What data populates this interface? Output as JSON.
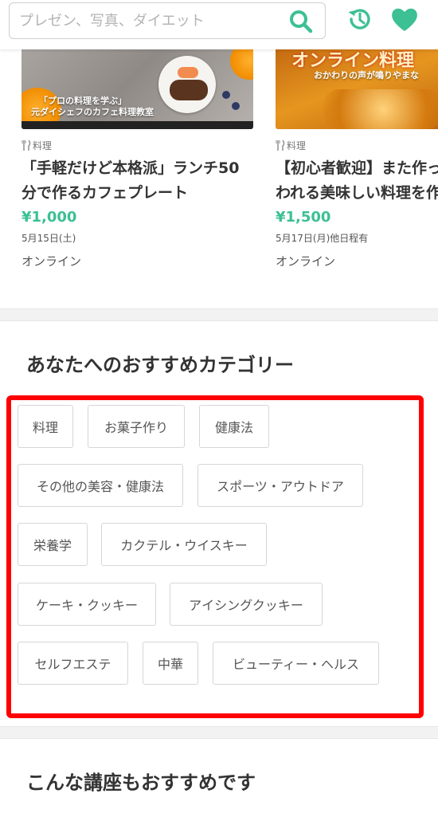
{
  "header": {
    "search_placeholder": "プレゼン、写真、ダイエット",
    "search_icon": "search-icon",
    "history_icon": "history-icon",
    "favorite_icon": "heart-icon",
    "accent_color": "#3cc094"
  },
  "courses": [
    {
      "thumbnail_caption_line1": "「プロの料理を学ぶ」",
      "thumbnail_caption_line2": "元ダイシェフのカフェ料理教室",
      "category": "料理",
      "title_line1": "「手軽だけど本格派」ランチ50",
      "title_line2": "分で作るカフェプレート",
      "price": "¥1,000",
      "date": "5月15日(土)",
      "place": "オンライン"
    },
    {
      "thumbnail_title": "オンライン料理",
      "thumbnail_subtitle": "おかわりの声が鳴りやまな",
      "category": "料理",
      "title_line1": "【初心者歓迎】また作っ",
      "title_line2": "われる美味しい料理を作",
      "price": "¥1,500",
      "date": "5月17日(月)他日程有",
      "place": "オンライン"
    }
  ],
  "recommended_categories": {
    "title": "あなたへのおすすめカテゴリー",
    "highlight_color": "#ff0000",
    "items": [
      "料理",
      "お菓子作り",
      "健康法",
      "その他の美容・健康法",
      "スポーツ・アウトドア",
      "栄養学",
      "カクテル・ウイスキー",
      "ケーキ・クッキー",
      "アイシングクッキー",
      "セルフエステ",
      "中華",
      "ビューティー・ヘルス"
    ]
  },
  "more_courses": {
    "title": "こんな講座もおすすめです"
  }
}
